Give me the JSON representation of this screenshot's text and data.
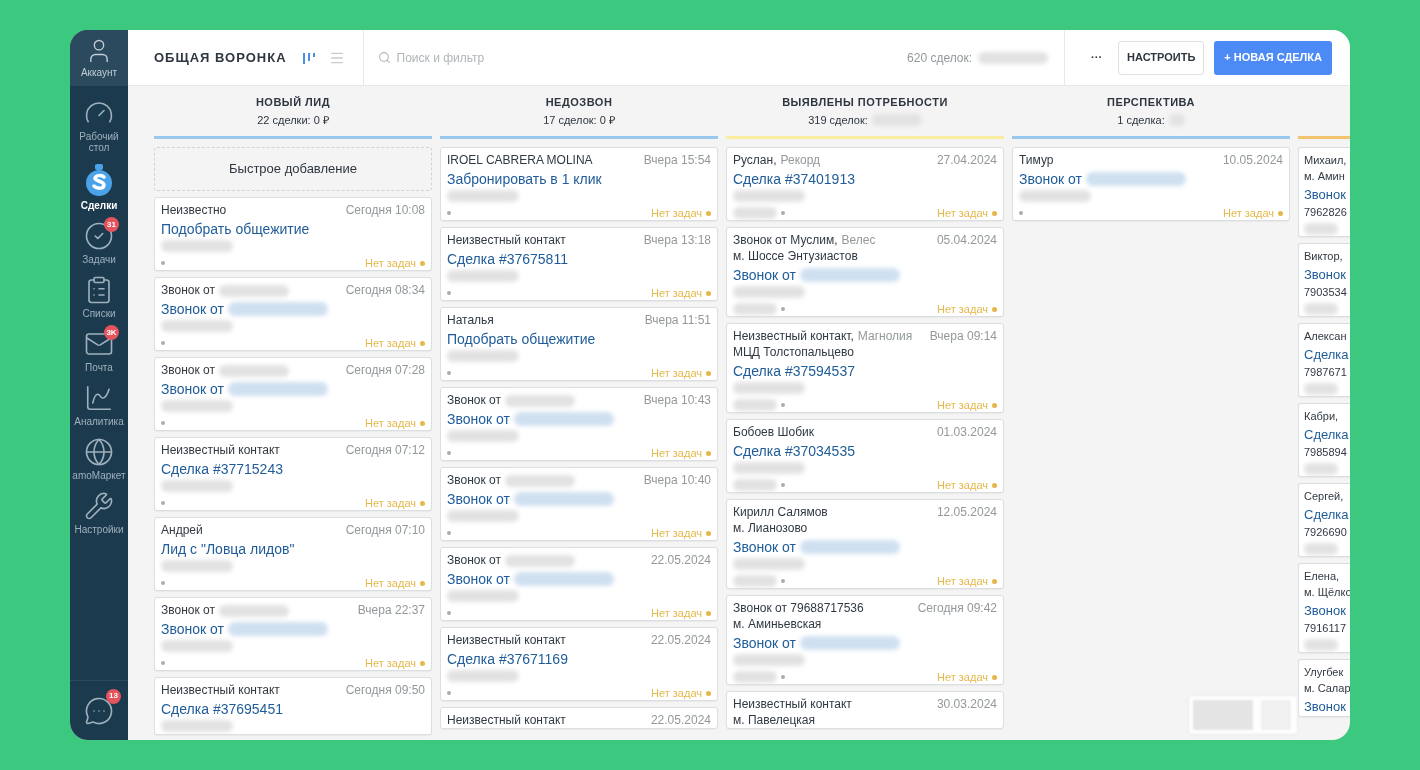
{
  "sidebar": {
    "account": {
      "label": "Аккаунт"
    },
    "items": [
      {
        "label": "Рабочий стол",
        "kind": "dashboard",
        "selected": false
      },
      {
        "label": "Сделки",
        "kind": "deals",
        "selected": true
      },
      {
        "label": "Задачи",
        "kind": "tasks",
        "selected": false,
        "badge": "31"
      },
      {
        "label": "Списки",
        "kind": "lists",
        "selected": false
      },
      {
        "label": "Почта",
        "kind": "mail",
        "selected": false,
        "badge": "3K"
      },
      {
        "label": "Аналитика",
        "kind": "analytics",
        "selected": false
      },
      {
        "label": "amoМаркет",
        "kind": "market",
        "selected": false
      },
      {
        "label": "Настройки",
        "kind": "settings",
        "selected": false
      }
    ],
    "chat": {
      "badge": "13"
    }
  },
  "header": {
    "title": "ОБЩАЯ ВОРОНКА",
    "views": [
      {
        "kind": "pipeline",
        "selected": true
      },
      {
        "kind": "list",
        "selected": false
      }
    ],
    "search": {
      "placeholder": "Поиск и фильтр"
    },
    "summary": "620 сделок:",
    "summary_redacted": true,
    "buttons": [
      {
        "label": "···",
        "kind": "more"
      },
      {
        "label": "НАСТРОИТЬ",
        "kind": "secondary"
      },
      {
        "label": "+ НОВАЯ СДЕЛКА",
        "kind": "primary"
      }
    ]
  },
  "columns": [
    {
      "title": "НОВЫЙ ЛИД",
      "count": "22 сделки: 0 ₽",
      "color": "#99c8ef",
      "quick_add": "Быстрое добавление",
      "cards": [
        {
          "contact": "Неизвестно",
          "date": "Сегодня 10:08",
          "title": "Подобрать общежитие",
          "phone_redacted": true,
          "tasks": "Нет задач"
        },
        {
          "contact": "Звонок от",
          "contact_redacted": true,
          "date": "Сегодня 08:34",
          "title": "Звонок от",
          "title_redacted": true,
          "phone_redacted": true,
          "tasks": "Нет задач"
        },
        {
          "contact": "Звонок от",
          "contact_redacted": true,
          "date": "Сегодня 07:28",
          "title": "Звонок от",
          "title_redacted": true,
          "phone_redacted": true,
          "tasks": "Нет задач"
        },
        {
          "contact": "Неизвестный контакт",
          "date": "Сегодня 07:12",
          "title": "Сделка #37715243",
          "phone_redacted": true,
          "tasks": "Нет задач"
        },
        {
          "contact": "Андрей",
          "date": "Сегодня 07:10",
          "title": "Лид с \"Ловца лидов\"",
          "phone_redacted": true,
          "tasks": "Нет задач"
        },
        {
          "contact": "Звонок от",
          "contact_redacted": true,
          "date": "Вчера 22:37",
          "title": "Звонок от",
          "title_redacted": true,
          "phone_redacted": true,
          "tasks": "Нет задач"
        },
        {
          "contact": "Неизвестный контакт",
          "date": "Сегодня 09:50",
          "title": "Сделка #37695451",
          "phone_redacted": true
        }
      ]
    },
    {
      "title": "НЕДОЗВОН",
      "count": "17 сделок: 0 ₽",
      "color": "#99c8ef",
      "cards": [
        {
          "contact": "IROEL CABRERA MOLINA",
          "date": "Вчера 15:54",
          "title": "Забронировать в 1 клик",
          "phone_redacted": true,
          "tasks": "Нет задач"
        },
        {
          "contact": "Неизвестный контакт",
          "date": "Вчера 13:18",
          "title": "Сделка #37675811",
          "phone_redacted": true,
          "tasks": "Нет задач"
        },
        {
          "contact": "Наталья",
          "date": "Вчера 11:51",
          "title": "Подобрать общежитие",
          "phone_redacted": true,
          "tasks": "Нет задач"
        },
        {
          "contact": "Звонок от",
          "contact_redacted": true,
          "date": "Вчера 10:43",
          "title": "Звонок от",
          "title_redacted": true,
          "phone_redacted": true,
          "tasks": "Нет задач"
        },
        {
          "contact": "Звонок от",
          "contact_redacted": true,
          "date": "Вчера 10:40",
          "title": "Звонок от",
          "title_redacted": true,
          "phone_redacted": true,
          "tasks": "Нет задач"
        },
        {
          "contact": "Звонок от",
          "contact_redacted": true,
          "date": "22.05.2024",
          "title": "Звонок от",
          "title_redacted": true,
          "phone_redacted": true,
          "tasks": "Нет задач"
        },
        {
          "contact": "Неизвестный контакт",
          "date": "22.05.2024",
          "title": "Сделка #37671169",
          "phone_redacted": true,
          "tasks": "Нет задач"
        },
        {
          "contact": "Неизвестный контакт",
          "date": "22.05.2024"
        }
      ]
    },
    {
      "title": "ВЫЯВЛЕНЫ ПОТРЕБНОСТИ",
      "count": "319 сделок:",
      "count_redacted": true,
      "color": "#fbeda0",
      "cards": [
        {
          "contact": "Руслан,",
          "company": "Рекорд",
          "date": "27.04.2024",
          "title": "Сделка #37401913",
          "phone_redacted": true,
          "price_redacted": true,
          "tasks": "Нет задач"
        },
        {
          "contact": "Звонок от Муслим,",
          "company": "Велес",
          "date": "05.04.2024",
          "address": "м. Шоссе Энтузиастов",
          "title": "Звонок от",
          "title_redacted": true,
          "phone_redacted": true,
          "price_redacted": true,
          "tasks": "Нет задач"
        },
        {
          "contact": "Неизвестный контакт,",
          "company": "Магнолия",
          "date": "Вчера 09:14",
          "address": "МЦД Толстопальцево",
          "title": "Сделка #37594537",
          "phone_redacted": true,
          "price_redacted": true,
          "tasks": "Нет задач"
        },
        {
          "contact": "Бобоев Шобик",
          "date": "01.03.2024",
          "title": "Сделка #37034535",
          "phone_redacted": true,
          "price_redacted": true,
          "tasks": "Нет задач"
        },
        {
          "contact": "Кирилл Салямов",
          "date": "12.05.2024",
          "address": "м. Лианозово",
          "title": "Звонок от",
          "title_redacted": true,
          "phone_redacted": true,
          "price_redacted": true,
          "tasks": "Нет задач"
        },
        {
          "contact": "Звонок от 79688717536",
          "date": "Сегодня 09:42",
          "address": "м. Аминьевская",
          "title": "Звонок от",
          "title_redacted": true,
          "phone_redacted": true,
          "price_redacted": true,
          "tasks": "Нет задач"
        },
        {
          "contact": "Неизвестный контакт",
          "date": "30.03.2024",
          "address": "м. Павелецкая"
        }
      ]
    },
    {
      "title": "ПЕРСПЕКТИВА",
      "count": "1 сделка:",
      "count_redacted": true,
      "color": "#99c8ef",
      "cards": [
        {
          "contact": "Тимур",
          "date": "10.05.2024",
          "title": "Звонок от",
          "title_redacted": true,
          "phone_redacted": true,
          "tasks": "Нет задач"
        }
      ]
    },
    {
      "color": "#f2c46e",
      "cards": [
        {
          "contact": "Михаил,",
          "address": "м. Амин",
          "title": "Звонок",
          "phone": "7962826",
          "price_redacted": true
        },
        {
          "contact": "Виктор,",
          "title": "Звонок",
          "phone": "7903534",
          "price_redacted": true
        },
        {
          "contact": "Алексан",
          "title": "Сделка",
          "phone": "7987671",
          "price_redacted": true
        },
        {
          "contact": "Кабри,",
          "title": "Сделка",
          "phone": "7985894",
          "price_redacted": true
        },
        {
          "contact": "Сергей,",
          "title": "Сделка",
          "phone": "7926690",
          "price_redacted": true
        },
        {
          "contact": "Елена,",
          "address": "м. Щёлко",
          "title": "Звонок",
          "phone": "7916117",
          "price_redacted": true
        },
        {
          "contact": "Улугбек",
          "address": "м. Салар",
          "title": "Звонок"
        }
      ]
    }
  ]
}
